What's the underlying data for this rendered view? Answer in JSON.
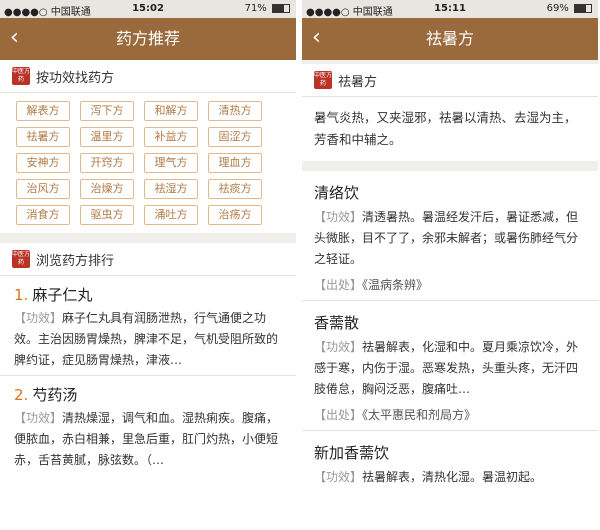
{
  "left": {
    "status": {
      "carrier": "●●●●○ 中国联通",
      "time": "15:02",
      "battery": "71%",
      "battery_level": 0.71
    },
    "nav": {
      "title": "药方推荐"
    },
    "effect_section": {
      "seal": "中医方药",
      "title": "按功效找药方"
    },
    "tags": [
      "解表方",
      "泻下方",
      "和解方",
      "清热方",
      "祛暑方",
      "温里方",
      "补益方",
      "固涩方",
      "安神方",
      "开窍方",
      "理气方",
      "理血方",
      "治风方",
      "治燥方",
      "祛湿方",
      "祛痰方",
      "消食方",
      "驱虫方",
      "涌吐方",
      "治疡方"
    ],
    "rank_section": {
      "seal": "中医方药",
      "title": "浏览药方排行"
    },
    "ranking": [
      {
        "num": "1.",
        "name": "麻子仁丸",
        "label": "【功效】",
        "desc": "麻子仁丸具有润肠泄热，行气通便之功效。主治因肠胃燥热，脾津不足，气机受阻所致的脾约证，症见肠胃燥热，津液…"
      },
      {
        "num": "2.",
        "name": "芍药汤",
        "label": "【功效】",
        "desc": "清热燥湿，调气和血。湿热痢疾。腹痛，便脓血，赤白相兼，里急后重，肛门灼热，小便短赤，舌苔黄腻，脉弦数。（…"
      }
    ]
  },
  "right": {
    "status": {
      "carrier": "●●●●○ 中国联通",
      "time": "15:11",
      "battery": "69%",
      "battery_level": 0.69
    },
    "nav": {
      "title": "祛暑方"
    },
    "category": {
      "seal": "中医方药",
      "title": "祛暑方",
      "intro": "暑气炎热，又夹湿邪，祛暑以清热、去湿为主， 芳香和中辅之。"
    },
    "formulas": [
      {
        "name": "清络饮",
        "label": "【功效】",
        "effect": "清透暑热。暑温经发汗后，暑证悉减，但头微胀，目不了了，余邪未解者；或暑伤肺经气分之轻证。",
        "src_label": "【出处】",
        "source": "《温病条辨》"
      },
      {
        "name": "香薷散",
        "label": "【功效】",
        "effect": "祛暑解表，化湿和中。夏月乘凉饮冷，外感于寒，内伤于湿。恶寒发热，头重头疼，无汗四肢倦怠，胸闷泛恶，腹痛吐…",
        "src_label": "【出处】",
        "source": "《太平惠民和剂局方》"
      },
      {
        "name": "新加香薷饮",
        "label": "【功效】",
        "effect": "祛暑解表，清热化湿。暑温初起。",
        "src_label": "",
        "source": ""
      }
    ]
  }
}
